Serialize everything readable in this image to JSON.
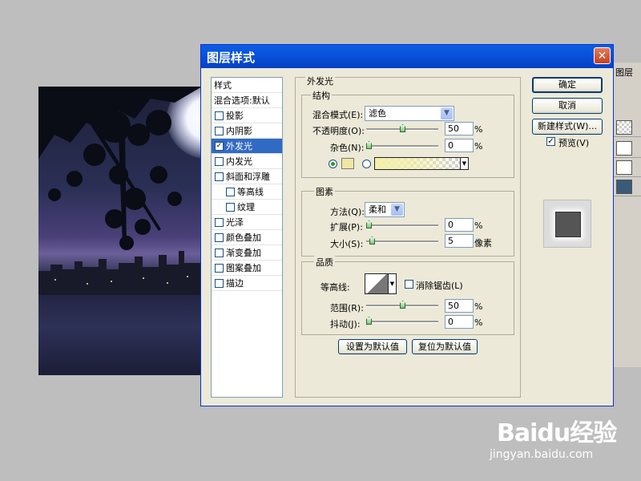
{
  "dialog": {
    "title": "图层样式",
    "close_glyph": "✕"
  },
  "layers_panel": {
    "tab_label": "图层"
  },
  "style_list": {
    "header": "样式",
    "blend_options": "混合选项:默认",
    "items": [
      {
        "label": "投影",
        "checked": false
      },
      {
        "label": "内阴影",
        "checked": false
      },
      {
        "label": "外发光",
        "checked": true
      },
      {
        "label": "内发光",
        "checked": false
      },
      {
        "label": "斜面和浮雕",
        "checked": false
      },
      {
        "label": "等高线",
        "checked": false
      },
      {
        "label": "纹理",
        "checked": false
      },
      {
        "label": "光泽",
        "checked": false
      },
      {
        "label": "颜色叠加",
        "checked": false
      },
      {
        "label": "渐变叠加",
        "checked": false
      },
      {
        "label": "图案叠加",
        "checked": false
      },
      {
        "label": "描边",
        "checked": false
      }
    ],
    "check_glyph": "✓"
  },
  "outer_glow": {
    "title": "外发光",
    "structure": {
      "title": "结构",
      "blend_mode_label": "混合模式(E):",
      "blend_mode_value": "滤色",
      "opacity_label": "不透明度(O):",
      "opacity_value": "50",
      "opacity_unit": "%",
      "opacity_fraction": 0.5,
      "noise_label": "杂色(N):",
      "noise_value": "0",
      "noise_unit": "%",
      "glow_color": "#efe7a2"
    },
    "elements": {
      "title": "图素",
      "technique_label": "方法(Q):",
      "technique_value": "柔和",
      "spread_label": "扩展(P):",
      "spread_value": "0",
      "spread_unit": "%",
      "size_label": "大小(S):",
      "size_value": "5",
      "size_unit": "像素"
    },
    "quality": {
      "title": "品质",
      "contour_label": "等高线:",
      "anti_alias_label": "消除锯齿(L)",
      "range_label": "范围(R):",
      "range_value": "50",
      "range_unit": "%",
      "jitter_label": "抖动(J):",
      "jitter_value": "0",
      "jitter_unit": "%"
    },
    "set_default_button": "设置为默认值",
    "reset_default_button": "复位为默认值"
  },
  "buttons": {
    "ok": "确定",
    "cancel": "取消",
    "new_style": "新建样式(W)...",
    "preview_label": "预览(V)",
    "preview_checked": true
  },
  "watermark": {
    "logo": "Baidu经验",
    "url": "jingyan.baidu.com"
  }
}
